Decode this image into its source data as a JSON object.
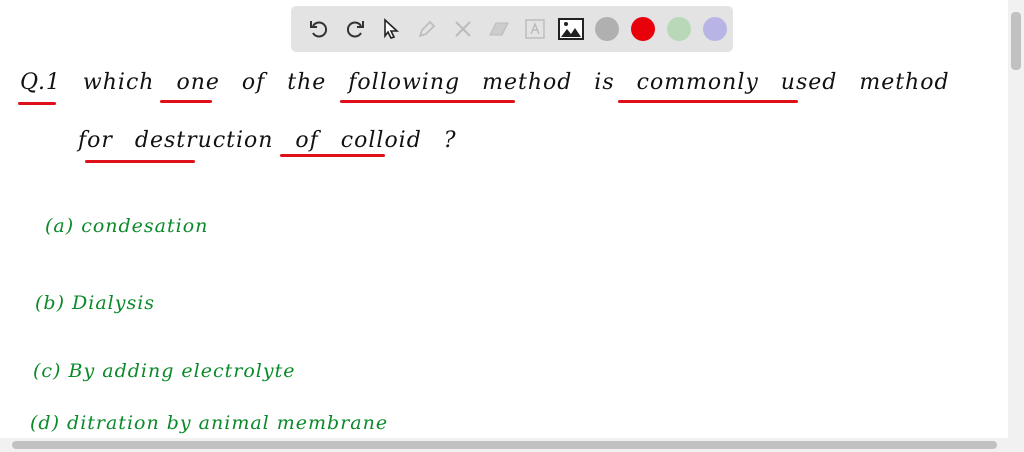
{
  "toolbar": {
    "tools": [
      "undo-icon",
      "redo-icon",
      "select-icon",
      "pen-icon",
      "tools-icon",
      "eraser-icon",
      "text-icon",
      "image-icon"
    ],
    "colors": [
      "#b0b0b0",
      "#e8000b",
      "#b8d8b8",
      "#b8b4e6"
    ]
  },
  "question": {
    "line1": "Q.1  which  one  of  the  following  method  is  commonly  used  method",
    "line2": "for  destruction  of  colloid ?"
  },
  "options": [
    "(a) condesation",
    "(b) Dialysis",
    "(c) By  adding  electrolyte",
    "(d) ditration  by  animal  membrane"
  ]
}
